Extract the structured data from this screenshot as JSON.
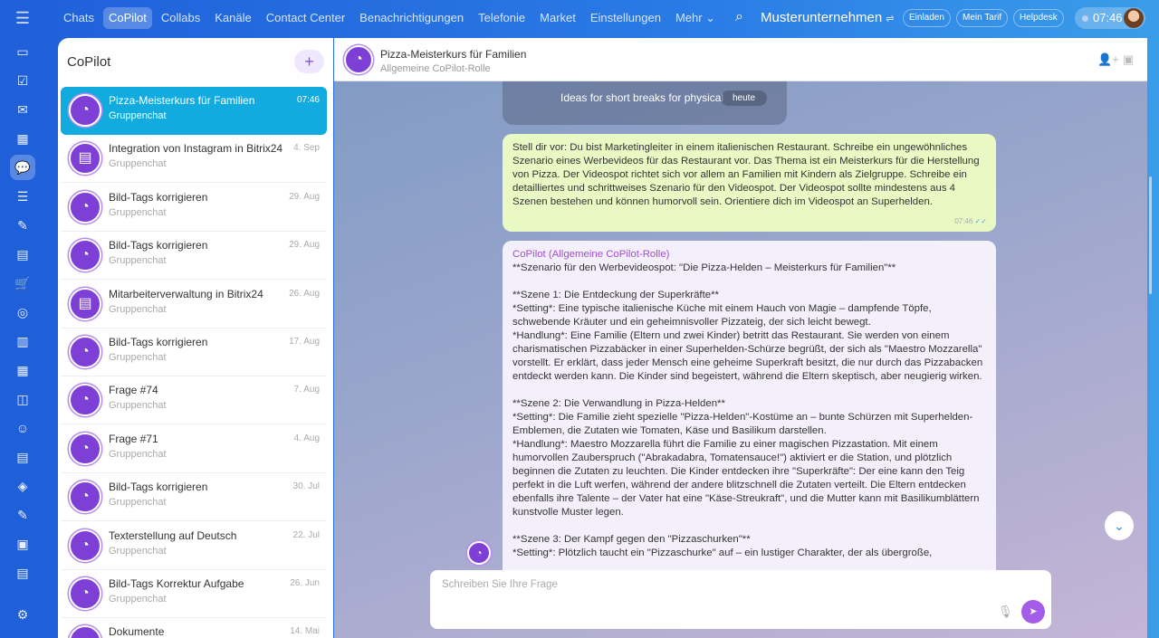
{
  "topnav": {
    "items": [
      "Chats",
      "CoPilot",
      "Collabs",
      "Kanäle",
      "Contact Center",
      "Benachrichtigungen",
      "Telefonie",
      "Market",
      "Einstellungen",
      "Mehr ⌄"
    ],
    "active": "CoPilot",
    "company": "Musterunternehmen",
    "invite": "Einladen",
    "tariff": "Mein Tarif",
    "helpdesk": "Helpdesk",
    "clock": "07:46"
  },
  "sidebar": {
    "title": "CoPilot",
    "items": [
      {
        "title": "Pizza-Meisterkurs für Familien",
        "subtitle": "Gruppenchat",
        "date": "07:46",
        "icon": "copilot"
      },
      {
        "title": "Integration von Instagram in Bitrix24",
        "subtitle": "Gruppenchat",
        "date": "4. Sep",
        "icon": "book"
      },
      {
        "title": "Bild-Tags korrigieren",
        "subtitle": "Gruppenchat",
        "date": "29. Aug",
        "icon": "copilot"
      },
      {
        "title": "Bild-Tags korrigieren",
        "subtitle": "Gruppenchat",
        "date": "29. Aug",
        "icon": "copilot"
      },
      {
        "title": "Mitarbeiterverwaltung in Bitrix24",
        "subtitle": "Gruppenchat",
        "date": "26. Aug",
        "icon": "book"
      },
      {
        "title": "Bild-Tags korrigieren",
        "subtitle": "Gruppenchat",
        "date": "17. Aug",
        "icon": "copilot"
      },
      {
        "title": "Frage #74",
        "subtitle": "Gruppenchat",
        "date": "7. Aug",
        "icon": "copilot"
      },
      {
        "title": "Frage #71",
        "subtitle": "Gruppenchat",
        "date": "4. Aug",
        "icon": "copilot"
      },
      {
        "title": "Bild-Tags korrigieren",
        "subtitle": "Gruppenchat",
        "date": "30. Jul",
        "icon": "copilot"
      },
      {
        "title": "Texterstellung auf Deutsch",
        "subtitle": "Gruppenchat",
        "date": "22. Jul",
        "icon": "copilot"
      },
      {
        "title": "Bild-Tags Korrektur Aufgabe",
        "subtitle": "Gruppenchat",
        "date": "26. Jun",
        "icon": "copilot"
      },
      {
        "title": "Dokumente",
        "subtitle": "",
        "date": "14. Mai",
        "icon": "copilot"
      }
    ]
  },
  "chat": {
    "title": "Pizza-Meisterkurs für Familien",
    "subtitle": "Allgemeine CoPilot-Rolle",
    "pinned_preview": "Ideas for short breaks for physical",
    "date_divider": "heute",
    "user_message": "Stell dir vor: Du bist Marketingleiter in einem italienischen Restaurant. Schreibe ein ungewöhnliches Szenario eines Werbevideos für das Restaurant vor. Das Thema ist ein Meisterkurs für die Herstellung von Pizza. Der Videospot richtet sich vor allem an Familien mit Kindern als Zielgruppe. Schreibe ein detailliertes und schrittweises Szenario für den Videospot. Der Videospot sollte mindestens aus 4 Szenen bestehen und können humorvoll sein. Orientiere dich im Videospot an Superhelden.",
    "user_time": "07:46",
    "bot_author": "CoPilot (Allgemeine CoPilot-Rolle)",
    "bot_message": "**Szenario für den Werbevideospot: \"Die Pizza-Helden – Meisterkurs für Familien\"**\n\n**Szene 1: Die Entdeckung der Superkräfte**\n*Setting*: Eine typische italienische Küche mit einem Hauch von Magie – dampfende Töpfe, schwebende Kräuter und ein geheimnisvoller Pizzateig, der sich leicht bewegt.\n*Handlung*: Eine Familie (Eltern und zwei Kinder) betritt das Restaurant. Sie werden von einem charismatischen Pizzabäcker in einer Superhelden-Schürze begrüßt, der sich als \"Maestro Mozzarella\" vorstellt. Er erklärt, dass jeder Mensch eine geheime Superkraft besitzt, die nur durch das Pizzabacken entdeckt werden kann. Die Kinder sind begeistert, während die Eltern skeptisch, aber neugierig wirken.\n\n**Szene 2: Die Verwandlung in Pizza-Helden**\n*Setting*: Die Familie zieht spezielle \"Pizza-Helden\"-Kostüme an – bunte Schürzen mit Superhelden-Emblemen, die Zutaten wie Tomaten, Käse und Basilikum darstellen.\n*Handlung*: Maestro Mozzarella führt die Familie zu einer magischen Pizzastation. Mit einem humorvollen Zauberspruch (\"Abrakadabra, Tomatensauce!\") aktiviert er die Station, und plötzlich beginnen die Zutaten zu leuchten. Die Kinder entdecken ihre \"Superkräfte\": Der eine kann den Teig perfekt in die Luft werfen, während der andere blitzschnell die Zutaten verteilt. Die Eltern entdecken ebenfalls ihre Talente – der Vater hat eine \"Käse-Streukraft\", und die Mutter kann mit Basilikumblättern kunstvolle Muster legen.\n\n**Szene 3: Der Kampf gegen den \"Pizzaschurken\"**\n*Setting*: Plötzlich taucht ein \"Pizzaschurke\" auf – ein lustiger Charakter, der als übergroße,",
    "input_placeholder": "Schreiben Sie Ihre Frage"
  }
}
